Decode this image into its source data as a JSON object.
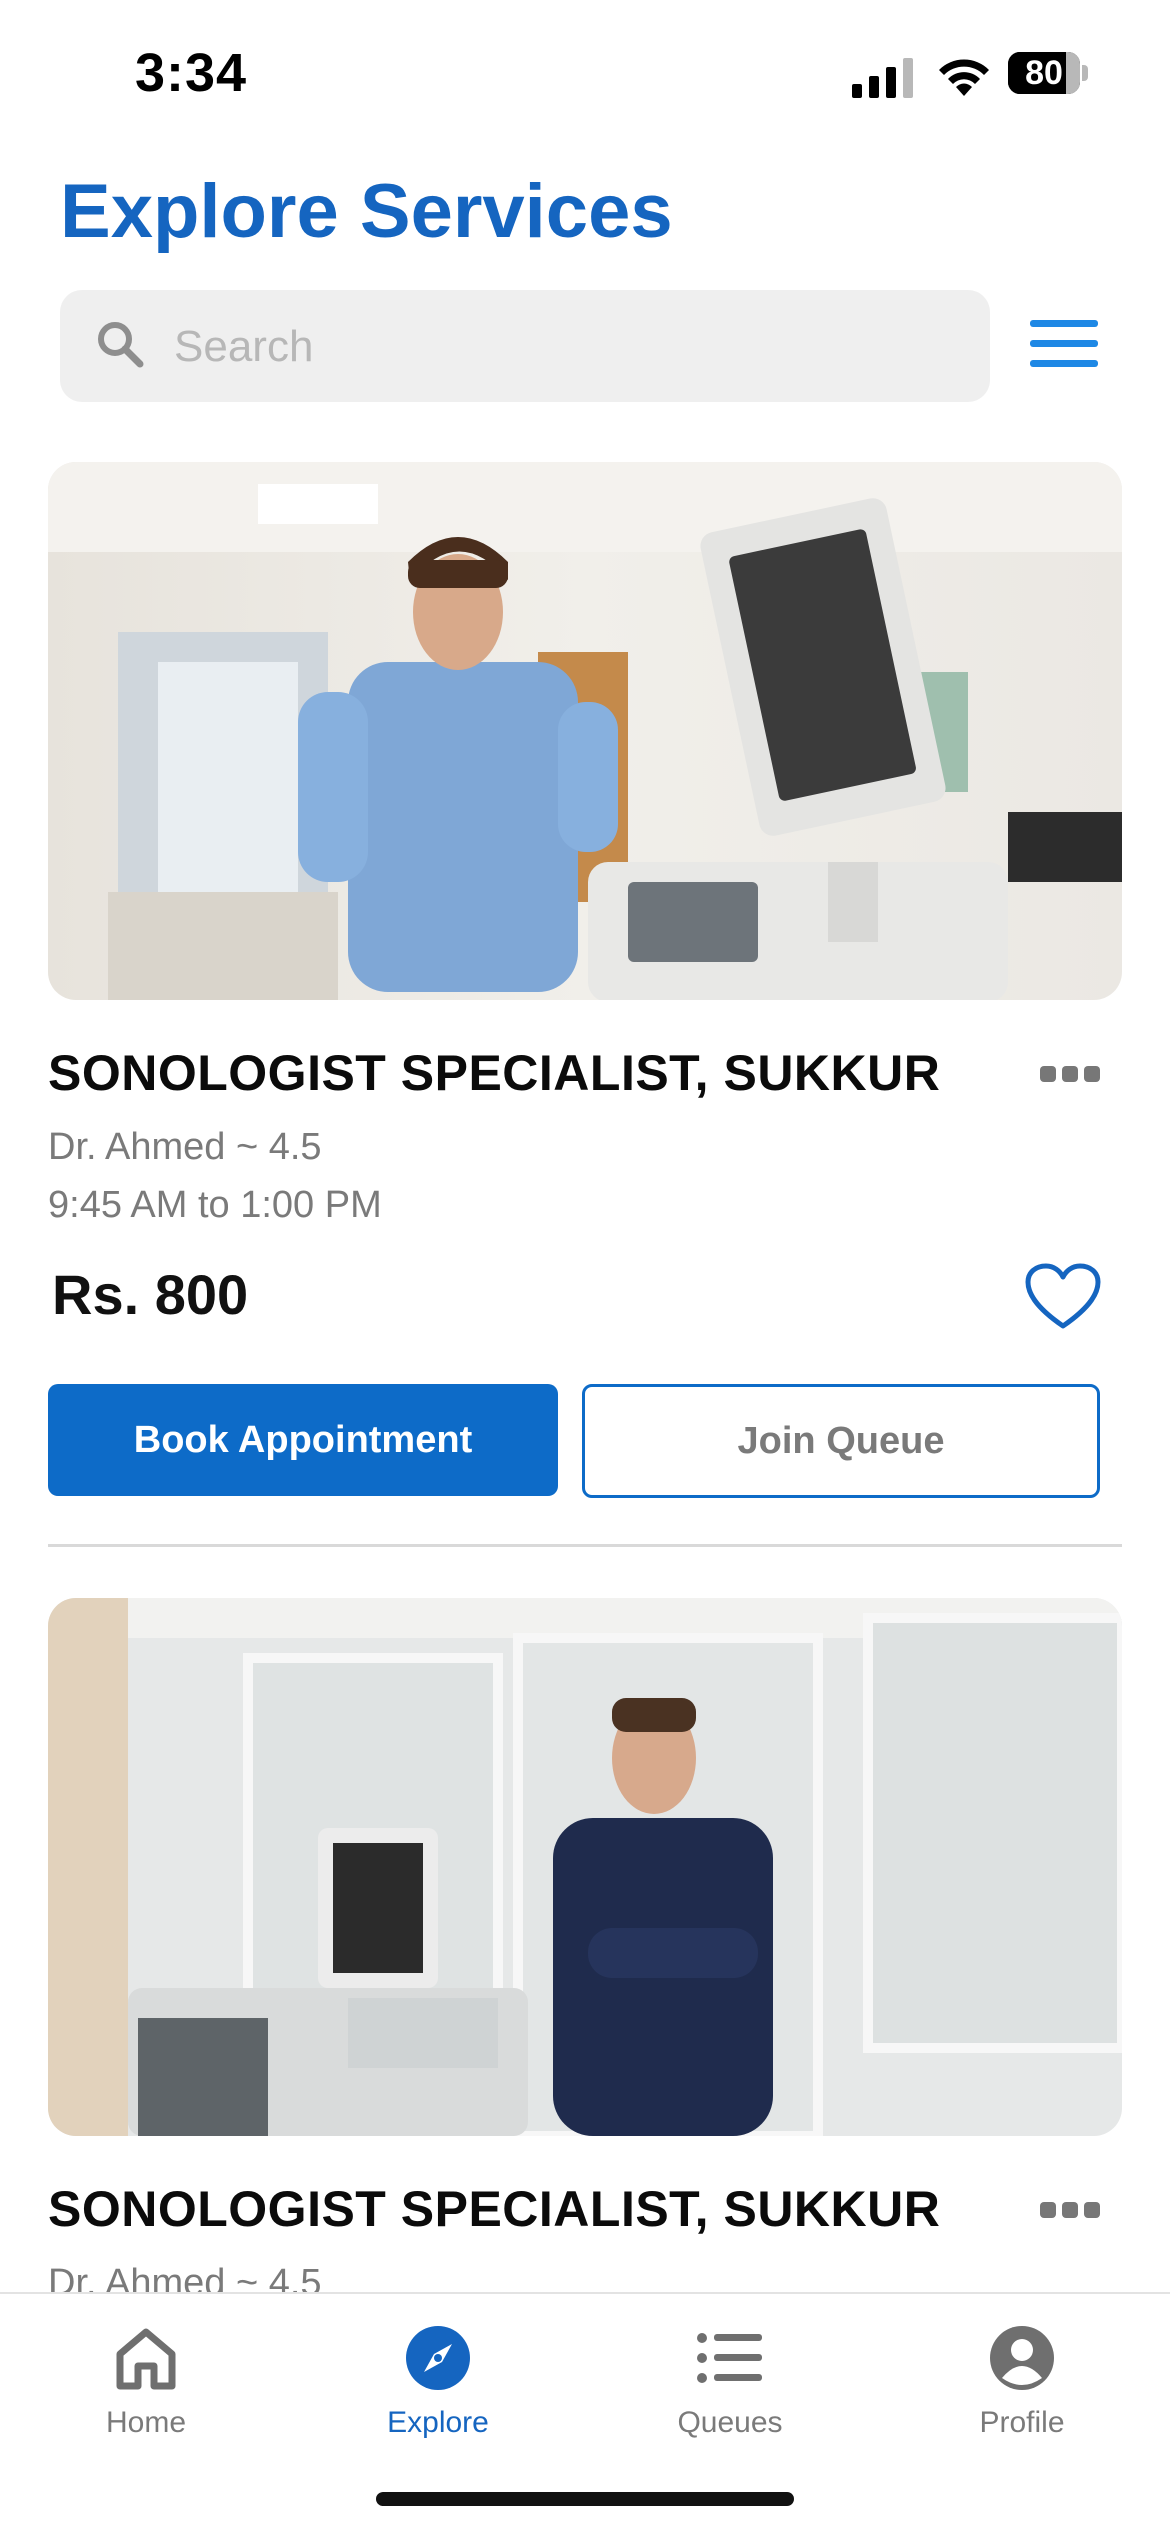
{
  "status_bar": {
    "time": "3:34",
    "battery": "80",
    "battery_level": 0.8
  },
  "header": {
    "title": "Explore Services"
  },
  "search": {
    "placeholder": "Search",
    "value": ""
  },
  "icons": {
    "search": "search-icon",
    "menu": "hamburger-menu-icon",
    "more": "more-horizontal-icon",
    "favorite": "heart-outline-icon",
    "home": "home-icon",
    "explore": "compass-icon",
    "queues": "list-icon",
    "profile": "user-circle-icon"
  },
  "colors": {
    "accent": "#1565C0",
    "button_primary": "#0D6BC8",
    "menu_icon": "#1E88E5",
    "muted_text": "#7a7a7a"
  },
  "services": [
    {
      "title": "SONOLOGIST SPECIALIST, SUKKUR",
      "doctor": "Dr. Ahmed ~ 4.5",
      "hours": "9:45 AM to 1:00 PM",
      "price": "Rs. 800",
      "book_label": "Book Appointment",
      "queue_label": "Join Queue"
    },
    {
      "title": "SONOLOGIST SPECIALIST, SUKKUR",
      "doctor": "Dr. Ahmed ~ 4.5"
    }
  ],
  "tabs": [
    {
      "label": "Home"
    },
    {
      "label": "Explore",
      "active": true
    },
    {
      "label": "Queues"
    },
    {
      "label": "Profile"
    }
  ]
}
